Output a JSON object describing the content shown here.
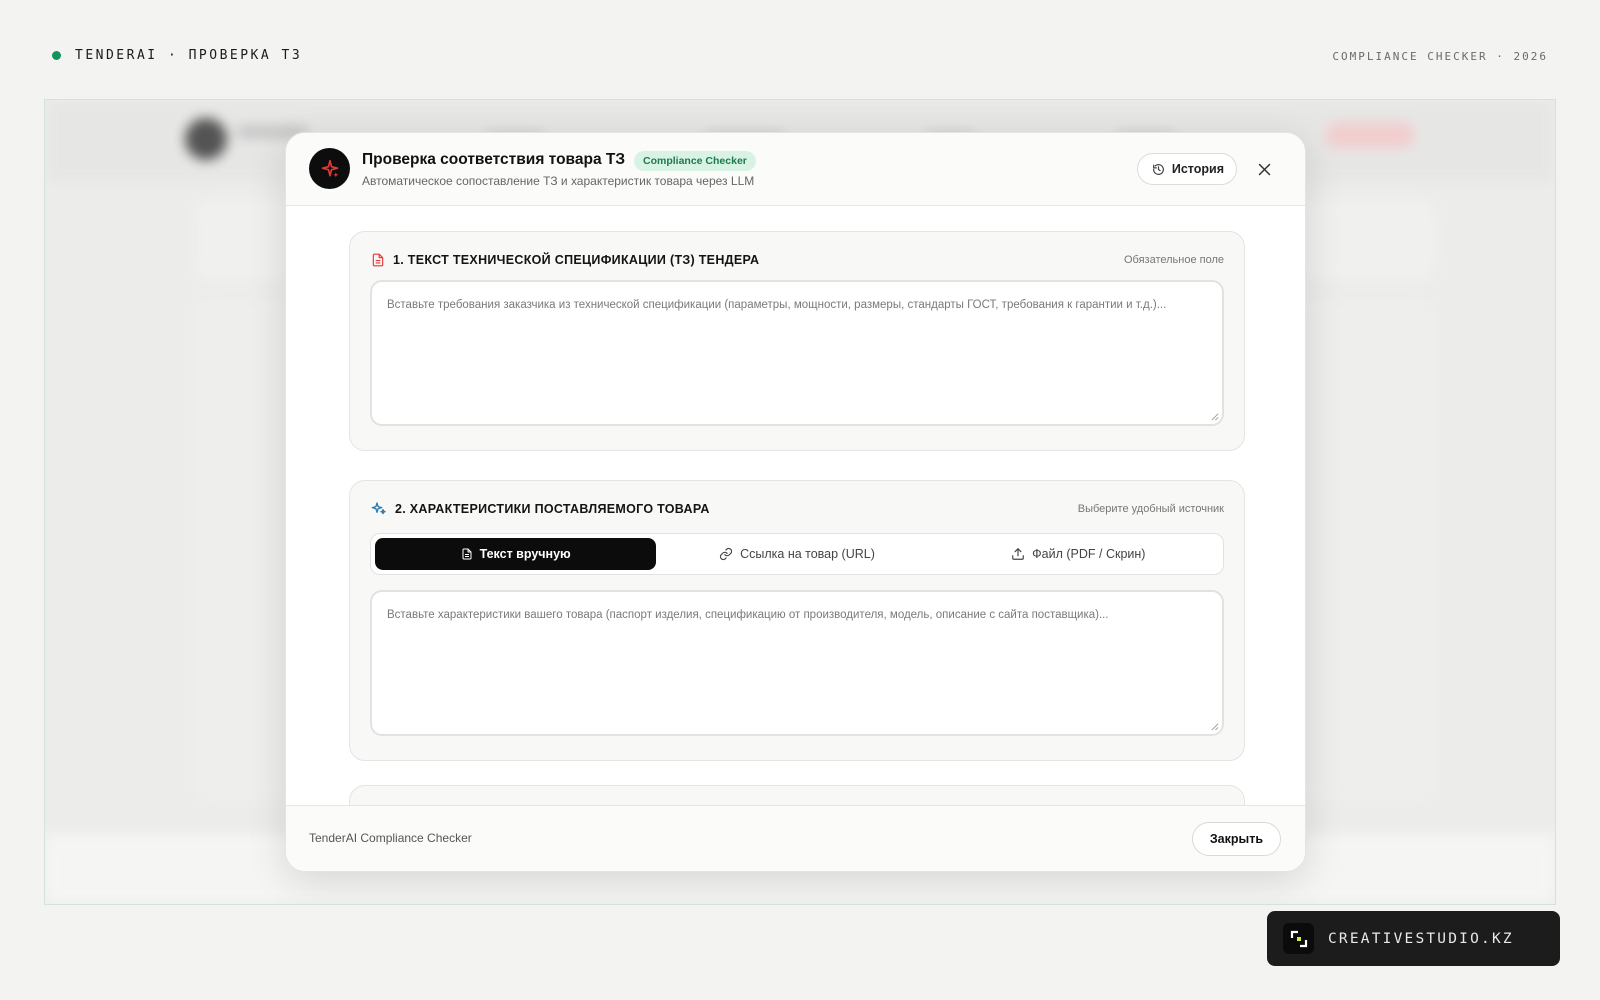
{
  "topbar": {
    "left_label": "TENDERAI · ПРОВЕРКА ТЗ",
    "right_label": "COMPLIANCE CHECKER · 2026",
    "status_color": "#12935b"
  },
  "modal": {
    "title": "Проверка соответствия товара ТЗ",
    "badge": "Compliance Checker",
    "subtitle": "Автоматическое сопоставление ТЗ и характеристик товара через LLM",
    "history_button": "История",
    "logo_icon": "sparkle-icon",
    "accent_color": "#e53935"
  },
  "section1": {
    "title": "1. ТЕКСТ ТЕХНИЧЕСКОЙ СПЕЦИФИКАЦИИ (ТЗ) ТЕНДЕРА",
    "note": "Обязательное поле",
    "placeholder": "Вставьте требования заказчика из технической спецификации (параметры, мощности, размеры, стандарты ГОСТ, требования к гарантии и т.д.)..."
  },
  "section2": {
    "title": "2. ХАРАКТЕРИСТИКИ ПОСТАВЛЯЕМОГО ТОВАРА",
    "note": "Выберите удобный источник",
    "tabs": [
      {
        "label": "Текст вручную",
        "icon": "document-icon",
        "active": true
      },
      {
        "label": "Ссылка на товар (URL)",
        "icon": "link-icon",
        "active": false
      },
      {
        "label": "Файл (PDF / Скрин)",
        "icon": "upload-icon",
        "active": false
      }
    ],
    "placeholder": "Вставьте характеристики вашего товара (паспорт изделия, спецификацию от производителя, модель, описание с сайта поставщика)..."
  },
  "footer": {
    "label": "TenderAI Compliance Checker",
    "close_button": "Закрыть"
  },
  "studio_badge": {
    "label": "CREATIVESTUDIO.KZ"
  }
}
